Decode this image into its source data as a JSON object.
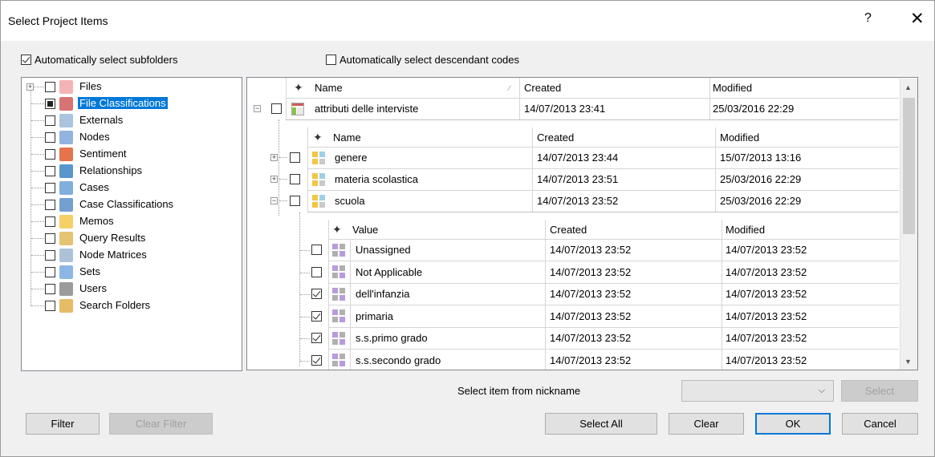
{
  "window": {
    "title": "Select Project Items",
    "help": "?",
    "close": "✕"
  },
  "options": {
    "subfolders": "Automatically select subfolders",
    "descendant": "Automatically select descendant codes"
  },
  "tree": [
    {
      "label": "Files",
      "icon": "files-icon",
      "color": "#f2a7a7",
      "state": "unchecked",
      "expander": "+"
    },
    {
      "label": "File Classifications",
      "icon": "file-classifications-icon",
      "color": "#d05a5a",
      "state": "partial",
      "selected": true
    },
    {
      "label": "Externals",
      "icon": "externals-icon",
      "color": "#9bb8d8",
      "state": "unchecked"
    },
    {
      "label": "Nodes",
      "icon": "nodes-icon",
      "color": "#7fa7d9",
      "state": "unchecked"
    },
    {
      "label": "Sentiment",
      "icon": "sentiment-icon",
      "color": "#e05a2b",
      "state": "unchecked"
    },
    {
      "label": "Relationships",
      "icon": "relationships-icon",
      "color": "#3d82c4",
      "state": "unchecked"
    },
    {
      "label": "Cases",
      "icon": "cases-icon",
      "color": "#6aa0d8",
      "state": "unchecked"
    },
    {
      "label": "Case Classifications",
      "icon": "case-classifications-icon",
      "color": "#5b8fc9",
      "state": "unchecked"
    },
    {
      "label": "Memos",
      "icon": "memos-icon",
      "color": "#f3c84b",
      "state": "unchecked"
    },
    {
      "label": "Query Results",
      "icon": "query-results-icon",
      "color": "#e2b75a",
      "state": "unchecked"
    },
    {
      "label": "Node Matrices",
      "icon": "node-matrices-icon",
      "color": "#9fb7d1",
      "state": "unchecked"
    },
    {
      "label": "Sets",
      "icon": "sets-icon",
      "color": "#78a9df",
      "state": "unchecked"
    },
    {
      "label": "Users",
      "icon": "users-icon",
      "color": "#8a8a8a",
      "state": "unchecked"
    },
    {
      "label": "Search Folders",
      "icon": "search-folders-icon",
      "color": "#e0b04a",
      "state": "unchecked"
    }
  ],
  "grid": {
    "headers": {
      "name": "Name",
      "created": "Created",
      "modified": "Modified",
      "value": "Value"
    },
    "classification": {
      "name": "attributi delle interviste",
      "created": "14/07/2013 23:41",
      "modified": "25/03/2016 22:29"
    },
    "attributes": [
      {
        "name": "genere",
        "created": "14/07/2013 23:44",
        "modified": "15/07/2013 13:16",
        "expander": "+"
      },
      {
        "name": "materia scolastica",
        "created": "14/07/2013 23:51",
        "modified": "25/03/2016 22:29",
        "expander": "+"
      },
      {
        "name": "scuola",
        "created": "14/07/2013 23:52",
        "modified": "25/03/2016 22:29",
        "expander": "−"
      }
    ],
    "values": [
      {
        "name": "Unassigned",
        "created": "14/07/2013 23:52",
        "modified": "14/07/2013 23:52",
        "checked": false
      },
      {
        "name": "Not Applicable",
        "created": "14/07/2013 23:52",
        "modified": "14/07/2013 23:52",
        "checked": false
      },
      {
        "name": "dell'infanzia",
        "created": "14/07/2013 23:52",
        "modified": "14/07/2013 23:52",
        "checked": true
      },
      {
        "name": "primaria",
        "created": "14/07/2013 23:52",
        "modified": "14/07/2013 23:52",
        "checked": true
      },
      {
        "name": "s.s.primo grado",
        "created": "14/07/2013 23:52",
        "modified": "14/07/2013 23:52",
        "checked": true
      },
      {
        "name": "s.s.secondo grado",
        "created": "14/07/2013 23:52",
        "modified": "14/07/2013 23:52",
        "checked": true
      }
    ]
  },
  "nickname": {
    "label": "Select item from nickname",
    "select": "Select"
  },
  "buttons": {
    "filter": "Filter",
    "clear_filter": "Clear Filter",
    "select_all": "Select All",
    "clear": "Clear",
    "ok": "OK",
    "cancel": "Cancel"
  }
}
